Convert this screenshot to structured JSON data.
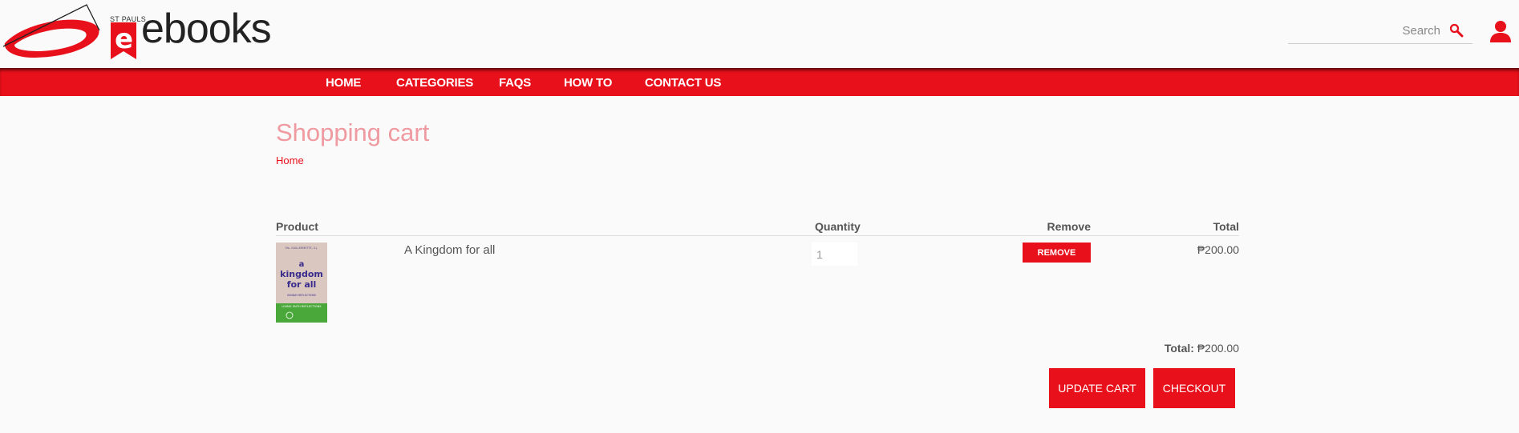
{
  "brand": {
    "small_text": "ST PAULS",
    "name": "ebooks",
    "colors": {
      "primary": "#e8101a",
      "title": "#ef9aa0"
    }
  },
  "search": {
    "placeholder": "Search",
    "icon": "search-icon"
  },
  "user": {
    "icon": "user-icon"
  },
  "nav": {
    "items": [
      {
        "label": "HOME"
      },
      {
        "label": "CATEGORIES"
      },
      {
        "label": "FAQS"
      },
      {
        "label": "HOW TO"
      },
      {
        "label": "CONTACT US"
      }
    ]
  },
  "page": {
    "title": "Shopping cart",
    "breadcrumb": "Home"
  },
  "cart": {
    "headers": {
      "product": "Product",
      "quantity": "Quantity",
      "remove": "Remove",
      "total": "Total"
    },
    "items": [
      {
        "name": "A Kingdom for all",
        "quantity": "1",
        "remove_label": "REMOVE",
        "total": "₱200.00",
        "cover": {
          "author": "Ma. GUILLERMETTE, S.J.",
          "title_lines": [
            "a",
            "kingdom",
            "for all"
          ],
          "subtitle": "SUNDAY REFLECTIONS",
          "band": "LIVING FAITH REFLECTIONS"
        }
      }
    ],
    "total_label": "Total:",
    "total_value": "₱200.00",
    "update_label": "UPDATE CART",
    "checkout_label": "CHECKOUT"
  }
}
